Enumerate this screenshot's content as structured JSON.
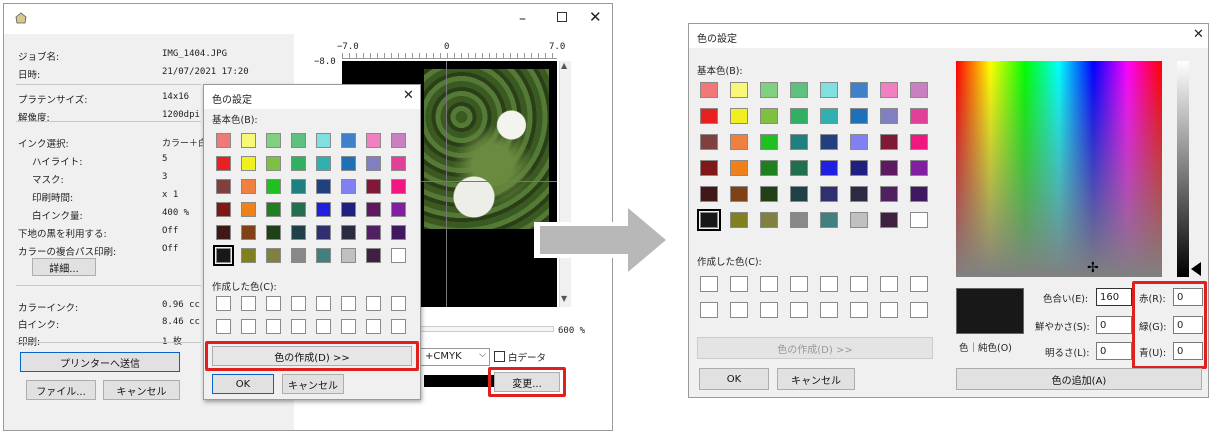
{
  "colors": {
    "red": "#e0201c",
    "arrow": "#b8b8b8",
    "accent": "#0a64c8"
  },
  "basic_colors": [
    "#f07878",
    "#f8f878",
    "#80d080",
    "#60c080",
    "#80e0e0",
    "#4080c8",
    "#f080c0",
    "#c880c0",
    "#e82020",
    "#f0f020",
    "#80c040",
    "#30b060",
    "#30b0b0",
    "#2070b8",
    "#8080c0",
    "#e04098",
    "#804040",
    "#f08040",
    "#20c020",
    "#208080",
    "#204080",
    "#8080f0",
    "#801838",
    "#f01880",
    "#801818",
    "#f08018",
    "#208020",
    "#207050",
    "#2020e0",
    "#202080",
    "#601860",
    "#8020a0",
    "#401818",
    "#804018",
    "#204018",
    "#204048",
    "#303070",
    "#2a2a40",
    "#502060",
    "#401860",
    "#181818",
    "#808020",
    "#808040",
    "#888888",
    "#408080",
    "#c0c0c0",
    "#402040",
    "#ffffff"
  ],
  "printer": {
    "title_icon": "printer-icon",
    "fields": [
      {
        "label": "ジョブ名:",
        "value": "IMG_1404.JPG"
      },
      {
        "label": "日時:",
        "value": "21/07/2021 17:20"
      },
      {
        "label": "プラテンサイズ:",
        "value": "14x16"
      },
      {
        "label": "解像度:",
        "value": "1200dpi x"
      },
      {
        "label": "インク選択:",
        "value": "カラー＋白"
      },
      {
        "label": "ハイライト:",
        "value": "5"
      },
      {
        "label": "マスク:",
        "value": "3"
      },
      {
        "label": "印刷時間:",
        "value": "x 1"
      },
      {
        "label": "白インク量:",
        "value": "400 %"
      },
      {
        "label": "下地の黒を利用する:",
        "value": "Off"
      },
      {
        "label": "カラーの複合パス印刷:",
        "value": "Off"
      },
      {
        "label": "カラーインク:",
        "value": "0.96 cc"
      },
      {
        "label": "白インク:",
        "value": "8.46 cc"
      },
      {
        "label": "印刷:",
        "value": "1 枚"
      }
    ],
    "detail_button": "詳細...",
    "send_button": "プリンターへ送信",
    "file_button": "ファイル...",
    "cancel_button": "キャンセル",
    "ruler_left": "−7.0",
    "ruler_mid": "0",
    "ruler_right": "7.0",
    "ruler_top": "−8.0",
    "zoom": "600 %",
    "cmyk_select": "+CMYK",
    "white_data_label": "白データ",
    "change_button": "変更..."
  },
  "small_dialog": {
    "title": "色の設定",
    "basic_label": "基本色(B):",
    "custom_label": "作成した色(C):",
    "define_button": "色の作成(D) >>",
    "ok_button": "OK",
    "cancel_button": "キャンセル"
  },
  "large_dialog": {
    "title": "色の設定",
    "basic_label": "基本色(B):",
    "custom_label": "作成した色(C):",
    "define_button": "色の作成(D) >>",
    "ok_button": "OK",
    "cancel_button": "キャンセル",
    "hue_label": "色合い(E):",
    "hue_value": "160",
    "sat_label": "鮮やかさ(S):",
    "sat_value": "0",
    "lum_label": "明るさ(L):",
    "lum_value": "0",
    "red_label": "赤(R):",
    "red_value": "0",
    "green_label": "緑(G):",
    "green_value": "0",
    "blue_label": "青(U):",
    "blue_value": "0",
    "color_solid_label": "色｜純色(O)",
    "add_button": "色の追加(A)"
  }
}
